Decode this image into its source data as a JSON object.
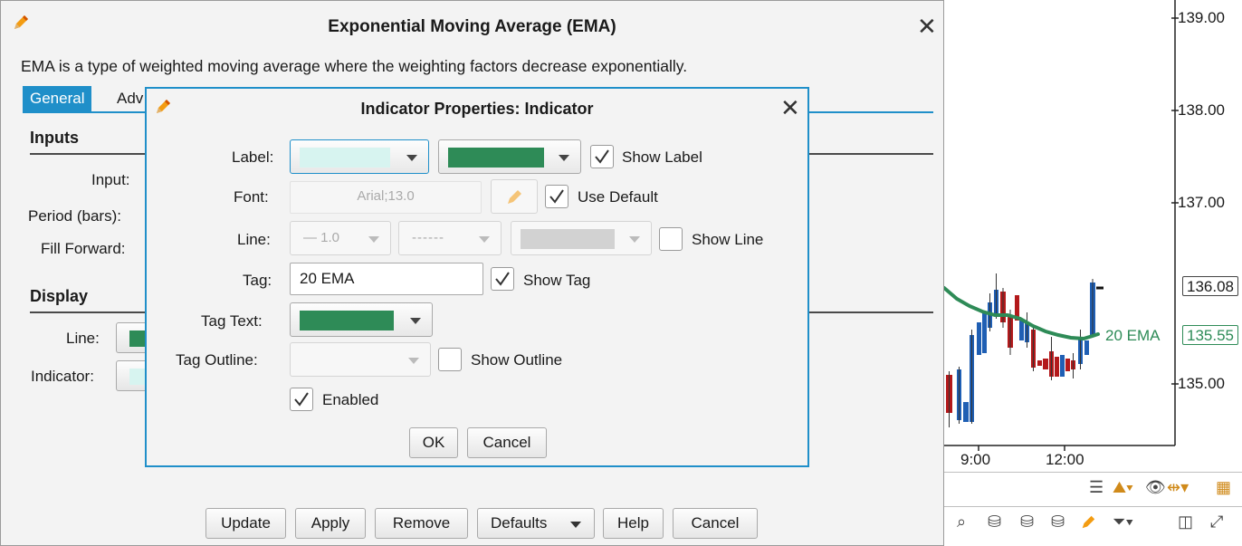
{
  "ema_dialog": {
    "title": "Exponential Moving Average (EMA)",
    "description": "EMA is a type of weighted moving average where the weighting factors decrease exponentially.",
    "tabs": [
      {
        "label": "General",
        "active": true
      },
      {
        "label": "Adv",
        "active": false
      }
    ],
    "sections": {
      "inputs": "Inputs",
      "display": "Display"
    },
    "fields": {
      "input": "Input:",
      "period": "Period (bars):",
      "fill_forward": "Fill Forward:",
      "line": "Line:",
      "indicator": "Indicator:"
    },
    "buttons": {
      "update": "Update",
      "apply": "Apply",
      "remove": "Remove",
      "defaults": "Defaults",
      "help": "Help",
      "cancel": "Cancel"
    }
  },
  "indicator_dialog": {
    "title": "Indicator Properties: Indicator",
    "label": {
      "label": "Label:",
      "show_label": "Show Label",
      "show_label_checked": true
    },
    "font": {
      "label": "Font:",
      "value": "Arial;13.0",
      "use_default": "Use Default",
      "use_default_checked": true
    },
    "line": {
      "label": "Line:",
      "width_value": "1.0",
      "show_line": "Show Line",
      "show_line_checked": false
    },
    "tag": {
      "label": "Tag:",
      "value": "20 EMA",
      "show_tag": "Show Tag",
      "show_tag_checked": true
    },
    "tag_text": {
      "label": "Tag Text:"
    },
    "tag_outline": {
      "label": "Tag Outline:",
      "show_outline": "Show Outline",
      "show_outline_checked": false
    },
    "enabled": {
      "label": "Enabled",
      "checked": true
    },
    "buttons": {
      "ok": "OK",
      "cancel": "Cancel"
    }
  },
  "chart": {
    "y_ticks": [
      "139.00",
      "138.00",
      "137.00",
      "135.00"
    ],
    "x_ticks": [
      "9:00",
      "12:00"
    ],
    "last_price_tag": "136.08",
    "ema_tag_label": "20 EMA",
    "ema_tag_value": "135.55"
  },
  "colors": {
    "accent": "#1f8fc9",
    "ema_green": "#2e8b57",
    "label_swatch": "#d7f4f0",
    "candle_up": "#1f5fb4",
    "candle_down": "#b3191b"
  },
  "icons": {
    "edit": "pencil-icon",
    "close": "close-icon",
    "menu": "hamburger-icon",
    "visible": "eye-icon",
    "calendar": "calendar-icon",
    "zoom": "magnify-icon",
    "filter": "filter-icon",
    "expand": "expand-icon"
  }
}
